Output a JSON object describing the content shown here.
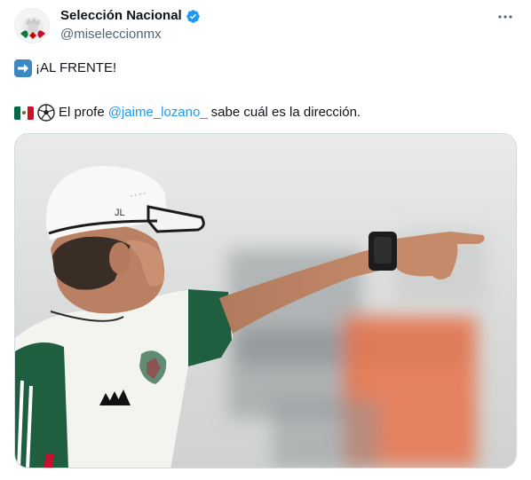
{
  "tweet": {
    "author": {
      "display_name": "Selección Nacional",
      "handle": "@miseleccionmx",
      "verified": true,
      "avatar_icon": "mexico-national-team-crest-icon"
    },
    "more_icon": "more-options-icon",
    "lines": [
      {
        "emoji": "right-arrow-emoji",
        "text": "¡AL FRENTE!"
      },
      {
        "emojis": [
          "mexico-flag-emoji",
          "soccer-ball-emoji"
        ],
        "before": "El profe",
        "mention": "@jaime_lozano_",
        "after": "sabe cuál es la dirección."
      }
    ],
    "image": {
      "cap_initials": "JL"
    }
  },
  "colors": {
    "link": "#1d9bf0",
    "secondary_text": "#536471",
    "verified": "#1d9bf0",
    "jersey_green": "#1f5f3f",
    "arrow_emoji_bg": "#3b88c3"
  }
}
